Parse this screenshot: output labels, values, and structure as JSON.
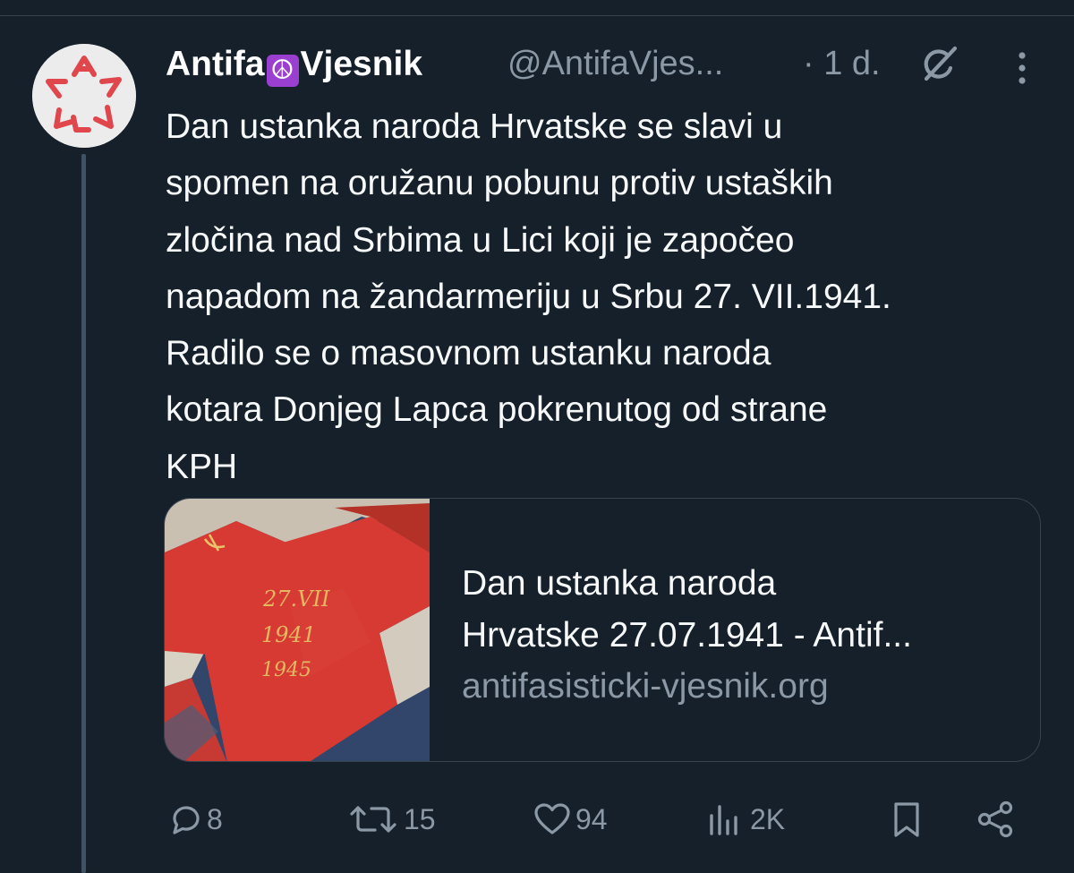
{
  "author": {
    "name_before_emoji": "Antifa",
    "emoji": "☮",
    "name_after_emoji": "Vjesnik",
    "handle": "@AntifaVjes...",
    "time": "· 1 d."
  },
  "tweet": {
    "lines": [
      "Dan ustanka naroda Hrvatske se slavi u",
      "spomen na oružanu pobunu protiv ustaških",
      "zločina nad Srbima u Lici koji je započeo",
      "napadom na žandarmeriju u Srbu 27. VII.1941.",
      "Radilo se o masovnom ustanku naroda",
      "kotara Donjeg Lapca pokrenutog od strane",
      "KPH"
    ]
  },
  "card": {
    "title_line1": "Dan ustanka naroda",
    "title_line2": "Hrvatske 27.07.1941 - Antif...",
    "domain": "antifasisticki-vjesnik.org",
    "image_text": {
      "date_top": "27.VII",
      "year_start": "1941",
      "year_end": "1945"
    }
  },
  "actions": {
    "replies": "8",
    "reposts": "15",
    "likes": "94",
    "views": "2K"
  },
  "icons": {
    "grok": "grok-icon",
    "more": "more-dots-icon",
    "reply": "reply-icon",
    "repost": "repost-icon",
    "like": "heart-icon",
    "views": "views-icon",
    "bookmark": "bookmark-icon",
    "share": "share-icon"
  },
  "colors": {
    "background": "#15202b",
    "text": "#f7f9f9",
    "secondary": "#8b98a5",
    "border": "#38444d",
    "emoji_bg": "#9a3fd0",
    "logo_red": "#e0474c",
    "flag_red": "#d63a33"
  }
}
